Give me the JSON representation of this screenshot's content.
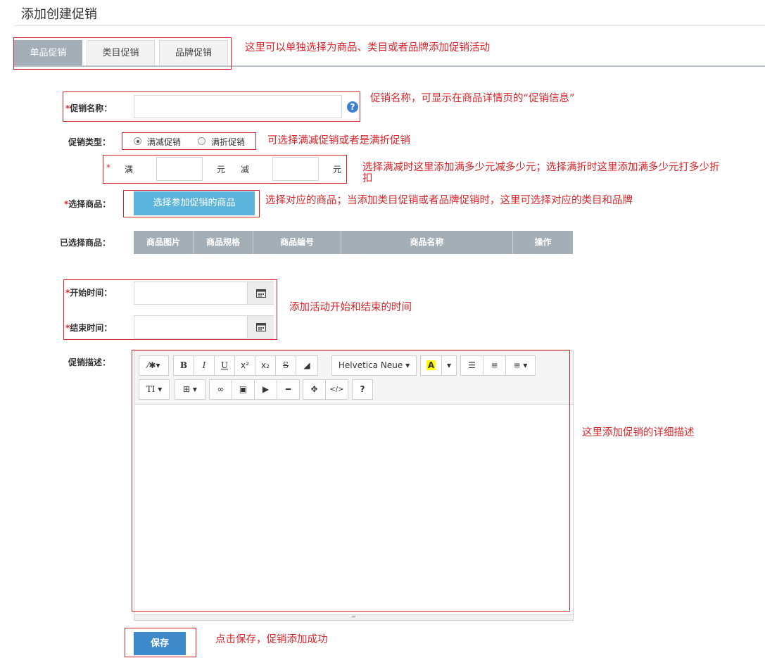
{
  "page": {
    "title": "添加创建促销"
  },
  "tabs": [
    {
      "label": "单品促销",
      "active": true
    },
    {
      "label": "类目促销",
      "active": false
    },
    {
      "label": "品牌促销",
      "active": false
    }
  ],
  "form": {
    "name_label": "促销名称：",
    "name_value": "",
    "type_label": "促销类型：",
    "type_options": [
      "满减促销",
      "满折促销"
    ],
    "type_selected": "满减促销",
    "rule": {
      "required_mark": "*",
      "full_text": "满",
      "yuan_text": "元",
      "minus_text": "减",
      "yuan2_text": "元"
    },
    "product_label": "选择商品：",
    "product_button": "选择参加促销的商品",
    "selected_label": "已选择商品：",
    "table_headers": [
      "商品图片",
      "商品规格",
      "商品编号",
      "商品名称",
      "操作"
    ],
    "start_label": "开始时间：",
    "end_label": "结束时间：",
    "desc_label": "促销描述：",
    "required_mark": "*",
    "save_button": "保存"
  },
  "editor": {
    "font_name": "Helvetica Neue",
    "icons": [
      "magic-wand-icon",
      "bold-icon",
      "italic-icon",
      "underline-icon",
      "superscript-icon",
      "subscript-icon",
      "strikethrough-icon",
      "eraser-icon",
      "font-color-icon",
      "unordered-list-icon",
      "ordered-list-icon",
      "align-icon",
      "font-size-icon",
      "table-icon",
      "link-icon",
      "image-icon",
      "video-icon",
      "horizontal-rule-icon",
      "fullscreen-icon",
      "code-view-icon",
      "help-icon"
    ]
  },
  "annotations": {
    "tabs_note": "这里可以单独选择为商品、类目或者品牌添加促销活动",
    "name_note": "促销名称，可显示在商品详情页的“促销信息”",
    "type_note": "可选择满减促销或者是满折促销",
    "rule_note_line1": "选择满减时这里添加满多少元减多少元；选择满折时这里添加满多少元打多少折",
    "rule_note_line2": "扣",
    "product_note": "选择对应的商品；当添加类目促销或者品牌促销时，这里可选择对应的类目和品牌",
    "time_note": "添加活动开始和结束的时间",
    "desc_note": "这里添加促销的详细描述",
    "save_note": "点击保存，促销添加成功"
  },
  "colors": {
    "annotation_red": "#d9242a",
    "tab_active": "#a3aeb6",
    "select_button": "#5ab4dc",
    "save_button": "#3e89c9",
    "help_icon": "#3a7fd0"
  }
}
